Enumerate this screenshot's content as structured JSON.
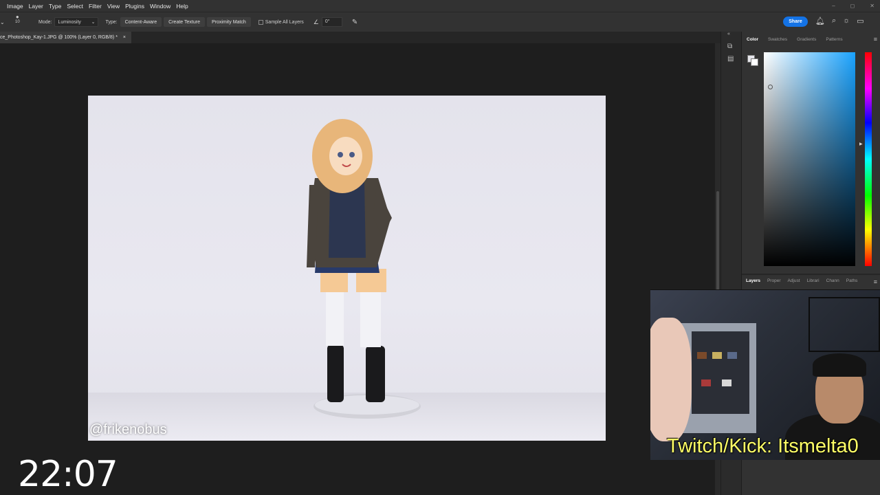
{
  "menu": [
    "Image",
    "Layer",
    "Type",
    "Select",
    "Filter",
    "View",
    "Plugins",
    "Window",
    "Help"
  ],
  "window_controls": [
    "–",
    "◻",
    "✕"
  ],
  "options_bar": {
    "brush_size": "10",
    "mode_label": "Mode:",
    "mode_value": "Luminosity",
    "type_label": "Type:",
    "type_buttons": [
      "Content-Aware",
      "Create Texture",
      "Proximity Match"
    ],
    "sample_all_layers": "Sample All Layers",
    "angle_value": "0°",
    "share_label": "Share"
  },
  "document_tab": {
    "title": "ce_Photoshop_Kay-1.JPG @ 100% (Layer 0, RGB/8) *",
    "close": "×"
  },
  "photo": {
    "watermark": "@frikenobus"
  },
  "color_panel": {
    "tabs": [
      "Color",
      "Swatches",
      "Gradients",
      "Patterns"
    ],
    "active_tab": "Color",
    "hue_color_top": "#ff0000",
    "picker_base_color": "#1aa3ff"
  },
  "layers_panel": {
    "tabs": [
      "Layers",
      "Proper",
      "Adjust",
      "Librari",
      "Chann",
      "Paths"
    ],
    "active_tab": "Layers"
  },
  "webcam": {
    "caption": "Twitch/Kick: Itsmelta0"
  },
  "clock": "22:07"
}
